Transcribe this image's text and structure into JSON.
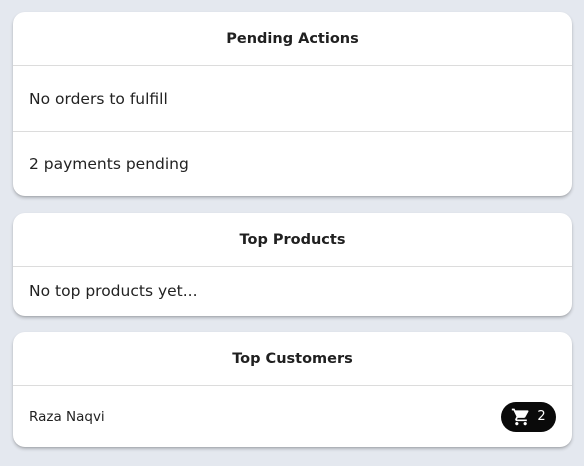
{
  "pending_actions": {
    "title": "Pending Actions",
    "items": [
      "No orders to fulfill",
      "2 payments pending"
    ]
  },
  "top_products": {
    "title": "Top Products",
    "empty_text": "No top products yet..."
  },
  "top_customers": {
    "title": "Top Customers",
    "customers": [
      {
        "name": "Raza Naqvi",
        "orders": "2",
        "icon": "cart-icon"
      }
    ]
  },
  "colors": {
    "background": "#e4e8ef",
    "card": "#ffffff",
    "badge": "#0a0a0a"
  }
}
